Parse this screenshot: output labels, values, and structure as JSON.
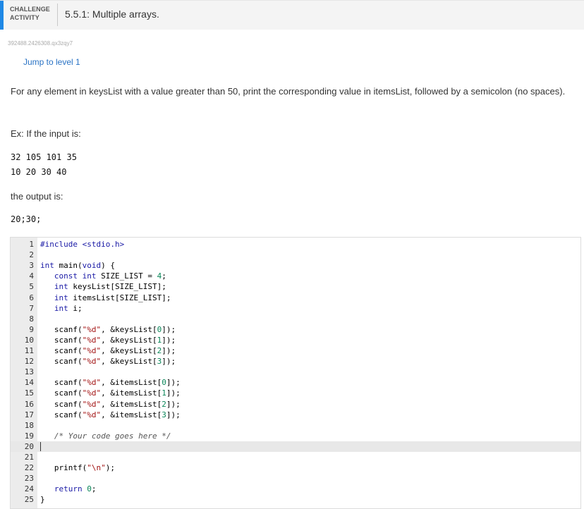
{
  "header": {
    "tag_line1": "CHALLENGE",
    "tag_line2": "ACTIVITY",
    "title": "5.5.1: Multiple arrays."
  },
  "activity_id": "392488.2426308.qx3zqy7",
  "jump_label": "Jump to level 1",
  "prompt": "For any element in keysList with a value greater than 50, print the corresponding value in itemsList, followed by a semicolon (no spaces).",
  "example_label": "Ex: If the input is:",
  "input_lines": [
    "32 105 101 35",
    "10 20 30 40"
  ],
  "output_label": "the output is:",
  "output": "20;30;",
  "code_lines": [
    "#include <stdio.h>",
    "",
    "int main(void) {",
    "   const int SIZE_LIST = 4;",
    "   int keysList[SIZE_LIST];",
    "   int itemsList[SIZE_LIST];",
    "   int i;",
    "",
    "   scanf(\"%d\", &keysList[0]);",
    "   scanf(\"%d\", &keysList[1]);",
    "   scanf(\"%d\", &keysList[2]);",
    "   scanf(\"%d\", &keysList[3]);",
    "",
    "   scanf(\"%d\", &itemsList[0]);",
    "   scanf(\"%d\", &itemsList[1]);",
    "   scanf(\"%d\", &itemsList[2]);",
    "   scanf(\"%d\", &itemsList[3]);",
    "",
    "   /* Your code goes here */",
    "",
    "",
    "   printf(\"\\n\");",
    "",
    "   return 0;",
    "}"
  ],
  "active_line": 20,
  "colors": {
    "accent": "#1e88e5",
    "link": "#2a73c5"
  }
}
